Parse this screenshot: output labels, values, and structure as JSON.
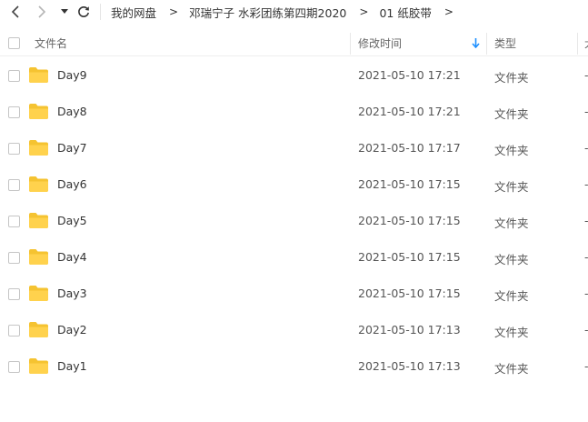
{
  "colors": {
    "folder": "#ffd24d",
    "folder_tab": "#f5c331",
    "accent": "#1e90ff",
    "text": "#333333",
    "muted": "#666666"
  },
  "toolbar": {
    "back_icon": "chevron-left-icon",
    "forward_icon": "chevron-right-icon",
    "history_icon": "caret-down-icon",
    "refresh_icon": "refresh-icon"
  },
  "breadcrumb": [
    {
      "label": "我的网盘"
    },
    {
      "label": "邓瑞宁子 水彩团练第四期2020"
    },
    {
      "label": "01 纸胶带"
    }
  ],
  "breadcrumb_separator": ">",
  "columns": {
    "name": "文件名",
    "modified": "修改时间",
    "type": "类型",
    "size_partial": "大"
  },
  "sort": {
    "column": "modified",
    "direction": "desc",
    "icon": "arrow-down-icon"
  },
  "files": [
    {
      "name": "Day9",
      "modified": "2021-05-10 17:21",
      "type": "文件夹",
      "size": "-"
    },
    {
      "name": "Day8",
      "modified": "2021-05-10 17:21",
      "type": "文件夹",
      "size": "-"
    },
    {
      "name": "Day7",
      "modified": "2021-05-10 17:17",
      "type": "文件夹",
      "size": "-"
    },
    {
      "name": "Day6",
      "modified": "2021-05-10 17:15",
      "type": "文件夹",
      "size": "-"
    },
    {
      "name": "Day5",
      "modified": "2021-05-10 17:15",
      "type": "文件夹",
      "size": "-"
    },
    {
      "name": "Day4",
      "modified": "2021-05-10 17:15",
      "type": "文件夹",
      "size": "-"
    },
    {
      "name": "Day3",
      "modified": "2021-05-10 17:15",
      "type": "文件夹",
      "size": "-"
    },
    {
      "name": "Day2",
      "modified": "2021-05-10 17:13",
      "type": "文件夹",
      "size": "-"
    },
    {
      "name": "Day1",
      "modified": "2021-05-10 17:13",
      "type": "文件夹",
      "size": "-"
    }
  ]
}
